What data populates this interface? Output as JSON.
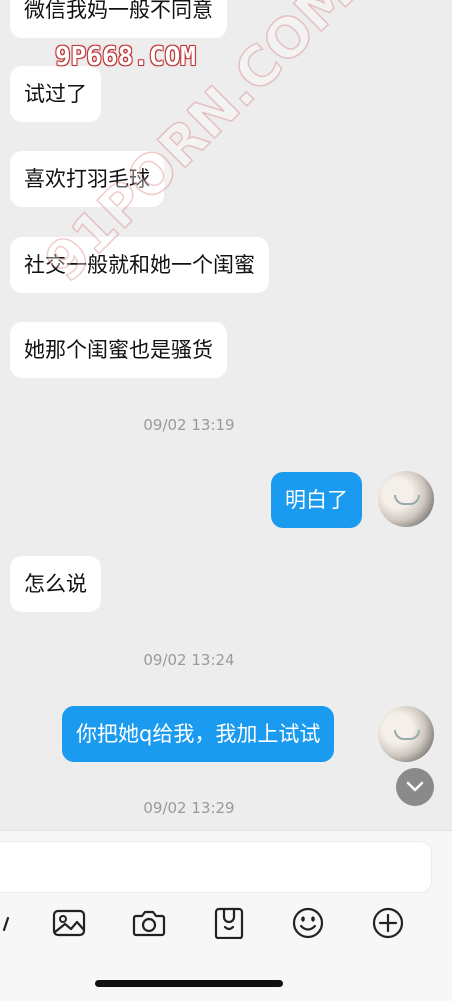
{
  "watermarks": {
    "top": "9P668.COM",
    "diagonal": "91PORN.COM"
  },
  "messages": [
    {
      "side": "in",
      "text": "微信我妈一般不同意"
    },
    {
      "side": "in",
      "text": "试过了"
    },
    {
      "side": "in",
      "text": "喜欢打羽毛球"
    },
    {
      "side": "in",
      "text": "社交一般就和她一个闺蜜"
    },
    {
      "side": "in",
      "text": "她那个闺蜜也是骚货"
    },
    {
      "type": "timestamp",
      "text": "09/02 13:19"
    },
    {
      "side": "out",
      "text": "明白了"
    },
    {
      "side": "in",
      "text": "怎么说"
    },
    {
      "type": "timestamp",
      "text": "09/02 13:24"
    },
    {
      "side": "out",
      "text": "你把她q给我，我加上试试"
    },
    {
      "type": "timestamp",
      "text": "09/02 13:29"
    }
  ],
  "colors": {
    "background": "#ededed",
    "incoming_bubble": "#ffffff",
    "outgoing_bubble": "#1a9bf0",
    "timestamp": "#9a9a9a"
  },
  "toolbar": {
    "icons": [
      "image-icon",
      "camera-icon",
      "sticker-icon",
      "emoji-icon",
      "add-icon"
    ]
  }
}
